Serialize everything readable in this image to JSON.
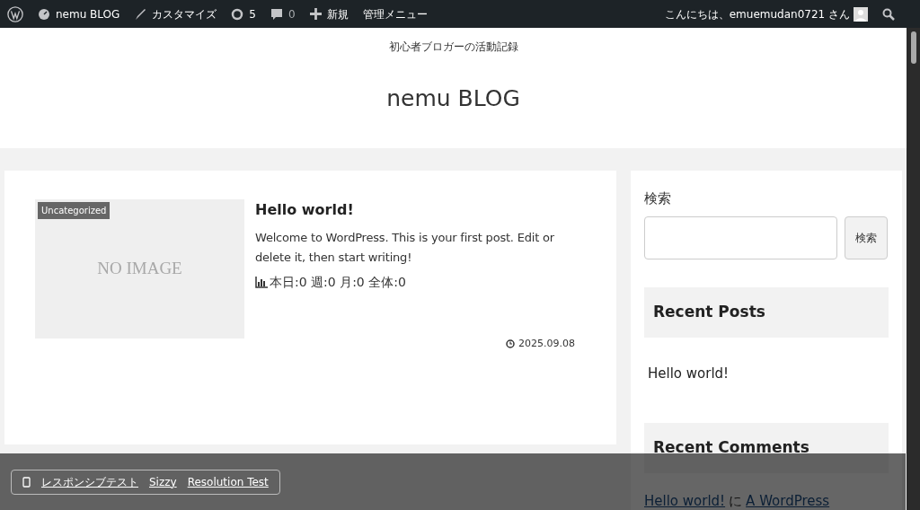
{
  "admin_bar": {
    "site": "nemu BLOG",
    "customize": "カスタマイズ",
    "updates": "5",
    "comments": "0",
    "new": "新規",
    "menu": "管理メニュー",
    "greeting": "こんにちは、emuemudan0721 さん"
  },
  "header": {
    "tagline": "初心者ブロガーの活動記録",
    "title": "nemu BLOG"
  },
  "post": {
    "category": "Uncategorized",
    "thumbnail": "NO IMAGE",
    "title": "Hello world!",
    "excerpt": "Welcome to WordPress. This is your first post. Edit or delete it, then start writing!",
    "stats": "本日:0 週:0 月:0 全体:0",
    "date": "2025.09.08"
  },
  "sidebar": {
    "search_label": "検索",
    "search_button": "検索",
    "recent_posts_title": "Recent Posts",
    "recent_posts": [
      "Hello world!"
    ],
    "recent_comments_title": "Recent Comments",
    "recent_comment": {
      "post": "Hello world!",
      "joiner": "に",
      "author": "A WordPress"
    }
  },
  "bottom_bar": {
    "links": [
      "レスポンシブテスト",
      "Sizzy",
      "Resolution Test"
    ]
  }
}
